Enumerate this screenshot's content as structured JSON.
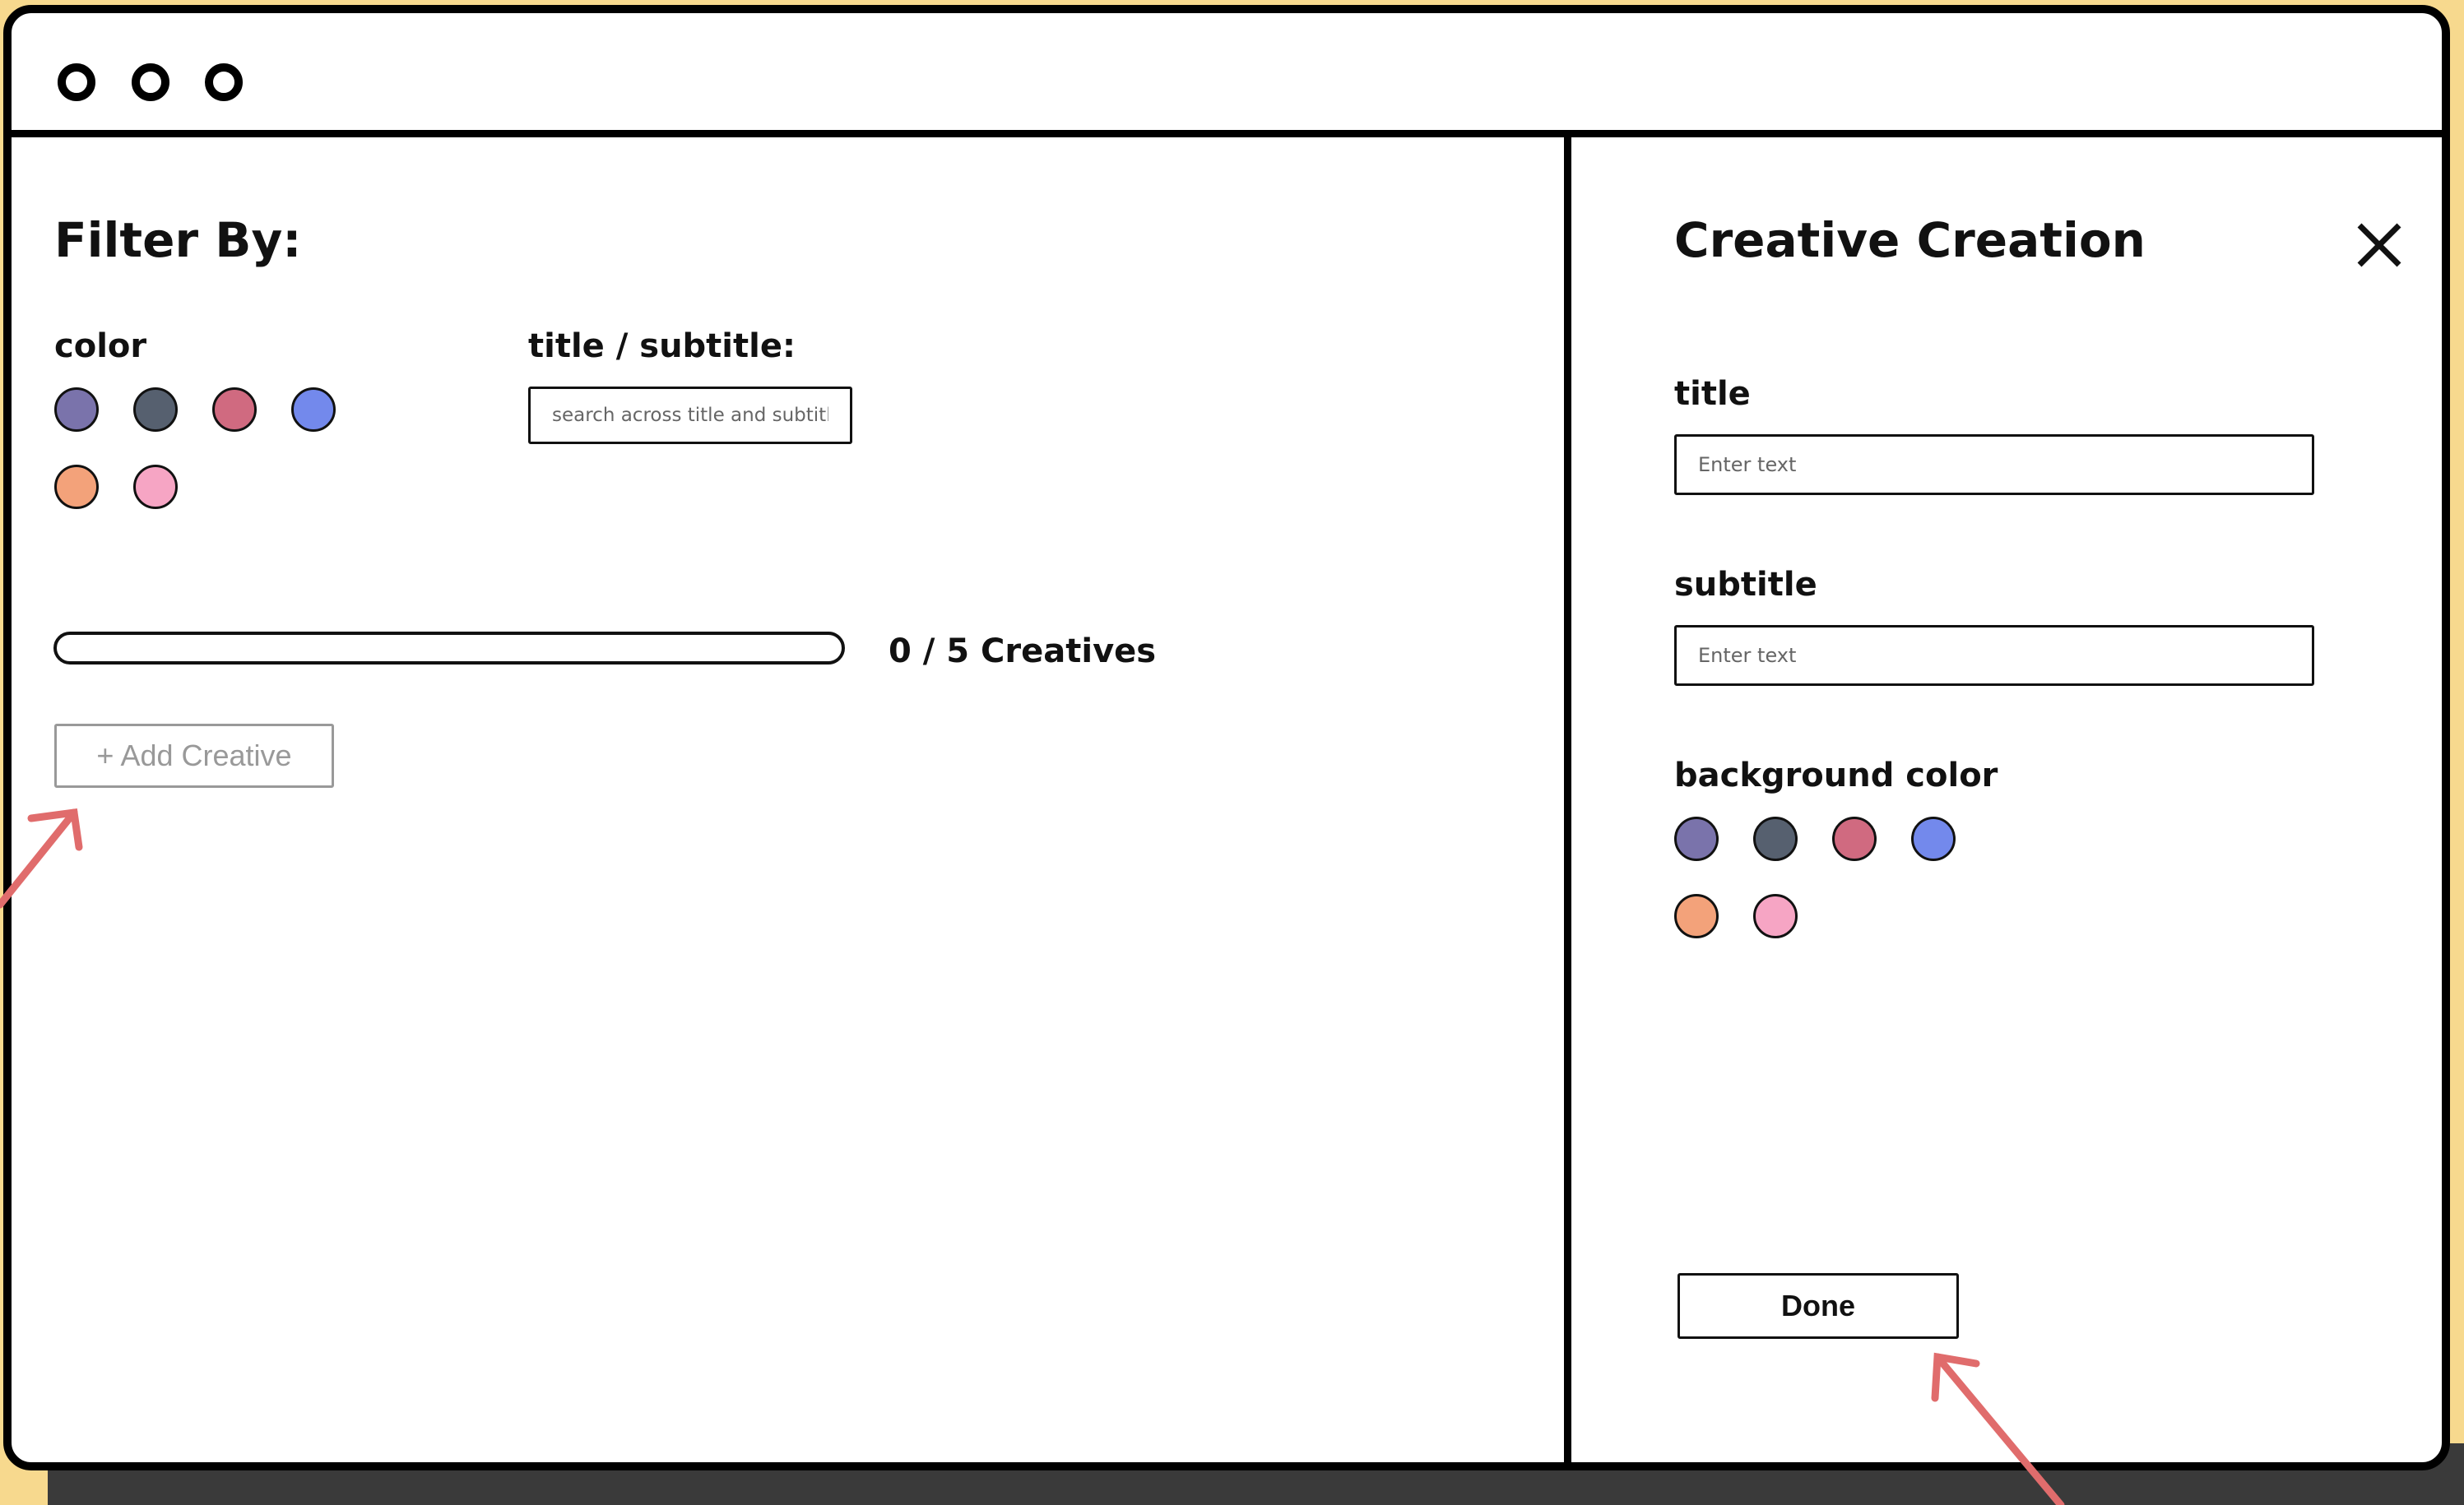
{
  "colors": {
    "swatches": [
      "#7a73ab",
      "#56606f",
      "#d06a80",
      "#7389ec",
      "#f3a27a",
      "#f6a5c4"
    ],
    "annotation_arrow": "#e06c6c",
    "backdrop": "#f7d98e"
  },
  "window_controls": [
    "window-dot",
    "window-dot",
    "window-dot"
  ],
  "filter": {
    "heading": "Filter By:",
    "color_label": "color",
    "title_label": "title / subtitle:",
    "search_placeholder": "search across title and subtitle",
    "progress_text": "0 / 5 Creatives",
    "progress_value": 0,
    "progress_max": 5,
    "add_button": "+ Add Creative"
  },
  "creation": {
    "heading": "Creative Creation",
    "close_icon": "x-close-icon",
    "title_label": "title",
    "title_placeholder": "Enter text",
    "subtitle_label": "subtitle",
    "subtitle_placeholder": "Enter text",
    "bg_label": "background color",
    "done_button": "Done"
  }
}
